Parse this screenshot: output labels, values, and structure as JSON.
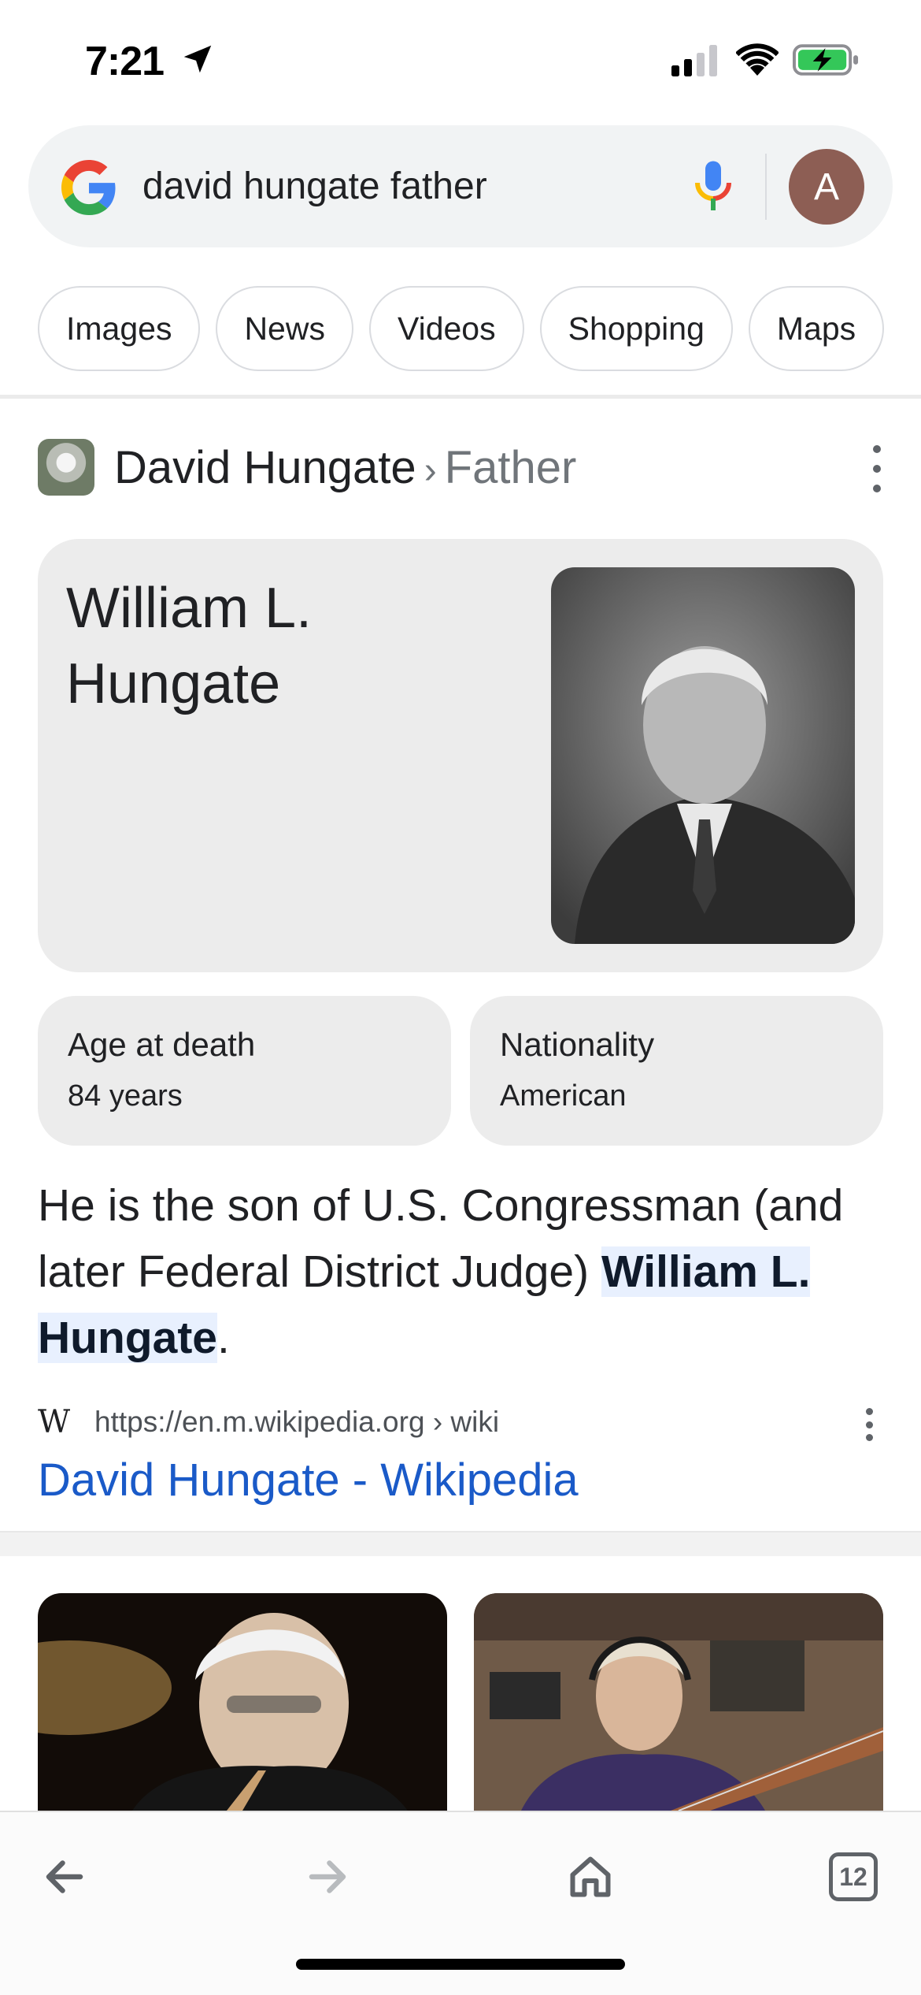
{
  "status_bar": {
    "time": "7:21",
    "icons": [
      "location-arrow-icon",
      "cellular-signal-icon",
      "wifi-icon",
      "battery-charging-icon"
    ],
    "battery_color": "#34c759"
  },
  "search": {
    "query": "david hungate father",
    "avatar_letter": "A",
    "avatar_color": "#8d5e54"
  },
  "filters": [
    "Images",
    "News",
    "Videos",
    "Shopping",
    "Maps"
  ],
  "result": {
    "entity": "David Hungate",
    "separator": "›",
    "attribute": "Father",
    "answer_name": "William L. Hungate",
    "facts": [
      {
        "label": "Age at death",
        "value": "84 years"
      },
      {
        "label": "Nationality",
        "value": "American"
      }
    ],
    "snippet": {
      "prefix": "He is the son of U.S. Congressman (and later Federal District Judge) ",
      "highlight": "William L. Hungate",
      "suffix": "."
    },
    "source_icon": "W",
    "source_url": "https://en.m.wikipedia.org › wiki",
    "link_title": "David Hungate - Wikipedia",
    "link_color": "#1a5ac8"
  },
  "toolbar": {
    "tab_count": "12",
    "icons": [
      "back-arrow-icon",
      "forward-arrow-icon",
      "home-icon",
      "tabs-icon"
    ]
  }
}
